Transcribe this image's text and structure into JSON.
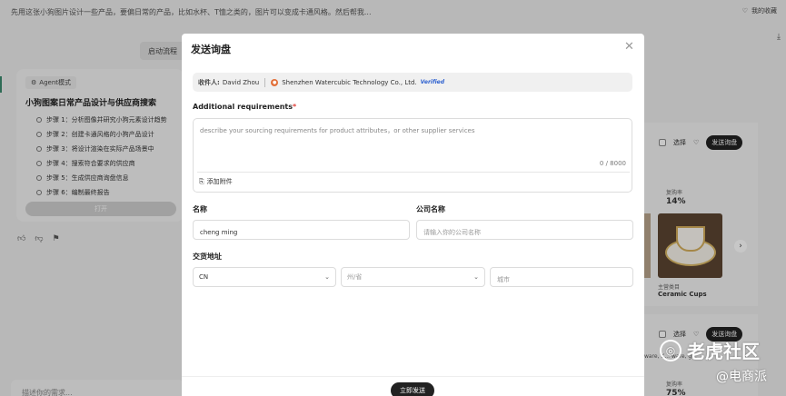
{
  "background": {
    "query": "先用这张小狗图片设计一些产品，要偏日常的产品，比如水杯、T恤之类的，图片可以变成卡通风格。然后帮我...",
    "favorites": "我的收藏",
    "flow_button": "启动流程",
    "agent_badge": "Agent模式",
    "agent_title": "小狗图案日常产品设计与供应商搜索",
    "steps": [
      "步骤 1：分析图像并研究小狗元素设计趋势",
      "步骤 2：创建卡通风格的小狗产品设计",
      "步骤 3：将设计渲染在实际产品场景中",
      "步骤 4：搜索符合要求的供应商",
      "步骤 5：生成供应商询盘信息",
      "步骤 6：编制最终报告"
    ],
    "open_button": "打开",
    "chat_placeholder": "描述你的需求...",
    "product_select": "选择",
    "product_inquiry": "发送询盘",
    "product_repurchase_label": "复购率",
    "product_repurchase": "14%",
    "product_type": "主营类目",
    "product_name": "Ceramic Cups",
    "product_tags": "ware, K... ware, g...",
    "product2_repurchase_label": "复购率",
    "product2_repurchase": "75%",
    "watermark_main": "老虎社区",
    "watermark_sub": "@电商派"
  },
  "modal": {
    "title": "发送询盘",
    "recipient_label": "收件人:",
    "recipient_name": "David Zhou",
    "company": "Shenzhen Watercubic Technology Co., Ltd.",
    "verified": "Verified",
    "requirements_label": "Additional requirements",
    "requirements_required_mark": "*",
    "requirements_placeholder": "describe your sourcing requirements for product attributes，or other supplier services",
    "char_count": "0 / 8000",
    "attach_label": "添加附件",
    "name_label": "名称",
    "name_value": "cheng ming",
    "company_label": "公司名称",
    "company_placeholder": "请输入你的公司名称",
    "address_label": "交货地址",
    "country_value": "CN",
    "province_placeholder": "州/省",
    "city_placeholder": "城市",
    "submit_label": "立即发送"
  },
  "icons": {
    "close": "close-icon",
    "attach": "paperclip-icon",
    "chevron": "chevron-down-icon",
    "heart": "heart-icon"
  }
}
